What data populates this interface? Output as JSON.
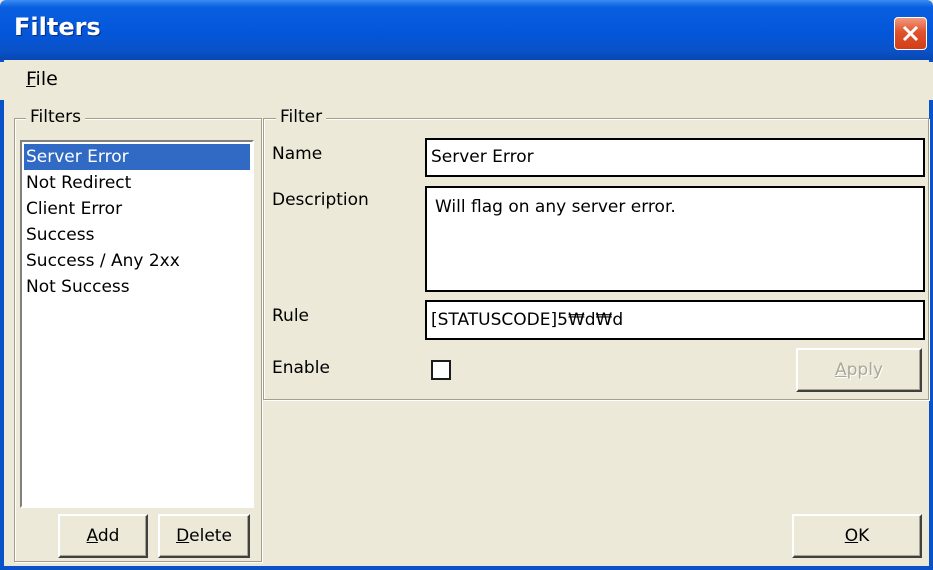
{
  "window": {
    "title": "Filters"
  },
  "menu": {
    "file_prefix": "",
    "file_mnemonic": "F",
    "file_rest": "ile"
  },
  "filters_group": {
    "label": "Filters",
    "items": [
      {
        "label": "Server Error",
        "selected": true
      },
      {
        "label": "Not Redirect",
        "selected": false
      },
      {
        "label": "Client Error",
        "selected": false
      },
      {
        "label": "Success",
        "selected": false
      },
      {
        "label": "Success / Any 2xx",
        "selected": false
      },
      {
        "label": "Not Success",
        "selected": false
      }
    ],
    "add_mnemonic": "A",
    "add_rest": "dd",
    "delete_mnemonic": "D",
    "delete_rest": "elete"
  },
  "filter_group": {
    "label": "Filter",
    "name_label": "Name",
    "name_value": "Server Error",
    "description_label": "Description",
    "description_value": "Will flag on any server error.",
    "rule_label": "Rule",
    "rule_value": "[STATUSCODE]5₩d₩d",
    "enable_label": "Enable",
    "enable_checked": false,
    "apply_mnemonic": "A",
    "apply_rest": "pply"
  },
  "footer": {
    "ok_mnemonic": "O",
    "ok_rest": "K"
  },
  "colors": {
    "titlebar": "#0356d9",
    "selection": "#316ac5",
    "close": "#e0532c",
    "face": "#ece9d8"
  }
}
